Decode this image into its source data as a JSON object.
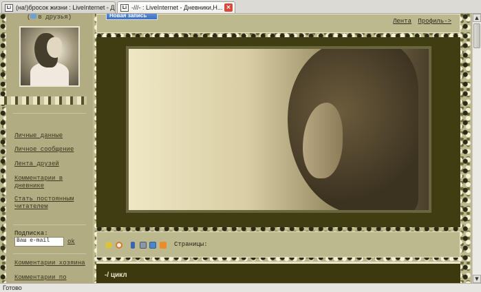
{
  "browser": {
    "tabs": [
      {
        "icon": "Li",
        "label": "(на!)бросок жизни : LiveInternet - Д..."
      },
      {
        "icon": "Li",
        "label": "-///- : LiveInternet - Дневники,Н..."
      }
    ],
    "status": "Готово"
  },
  "sidebar": {
    "friends_link": "в друзья",
    "menu": [
      "Личные данные",
      "Личное сообщение",
      "Лента друзей",
      "Комментарии в дневнике",
      "Стать постоянным читателем"
    ],
    "subscribe_label": "Подписка:",
    "email_placeholder": "Ваш e-mail",
    "ok_label": "ok",
    "bottom_links": [
      "Комментарии хозяина",
      "Комментарии по"
    ]
  },
  "header": {
    "new_post_label": "Новая запись",
    "links": [
      "Лента",
      "Профиль->"
    ]
  },
  "toolbar": {
    "pages_label": "Страницы:",
    "icons": [
      "star-icon",
      "clock-icon",
      "phone-icon",
      "print-icon",
      "save-icon",
      "rss-icon"
    ]
  },
  "post": {
    "title": "-/ цикл"
  },
  "colors": {
    "dark_panel": "#403d12",
    "khaki": "#bdb98f",
    "accent_blue": "#3e6fbe"
  }
}
